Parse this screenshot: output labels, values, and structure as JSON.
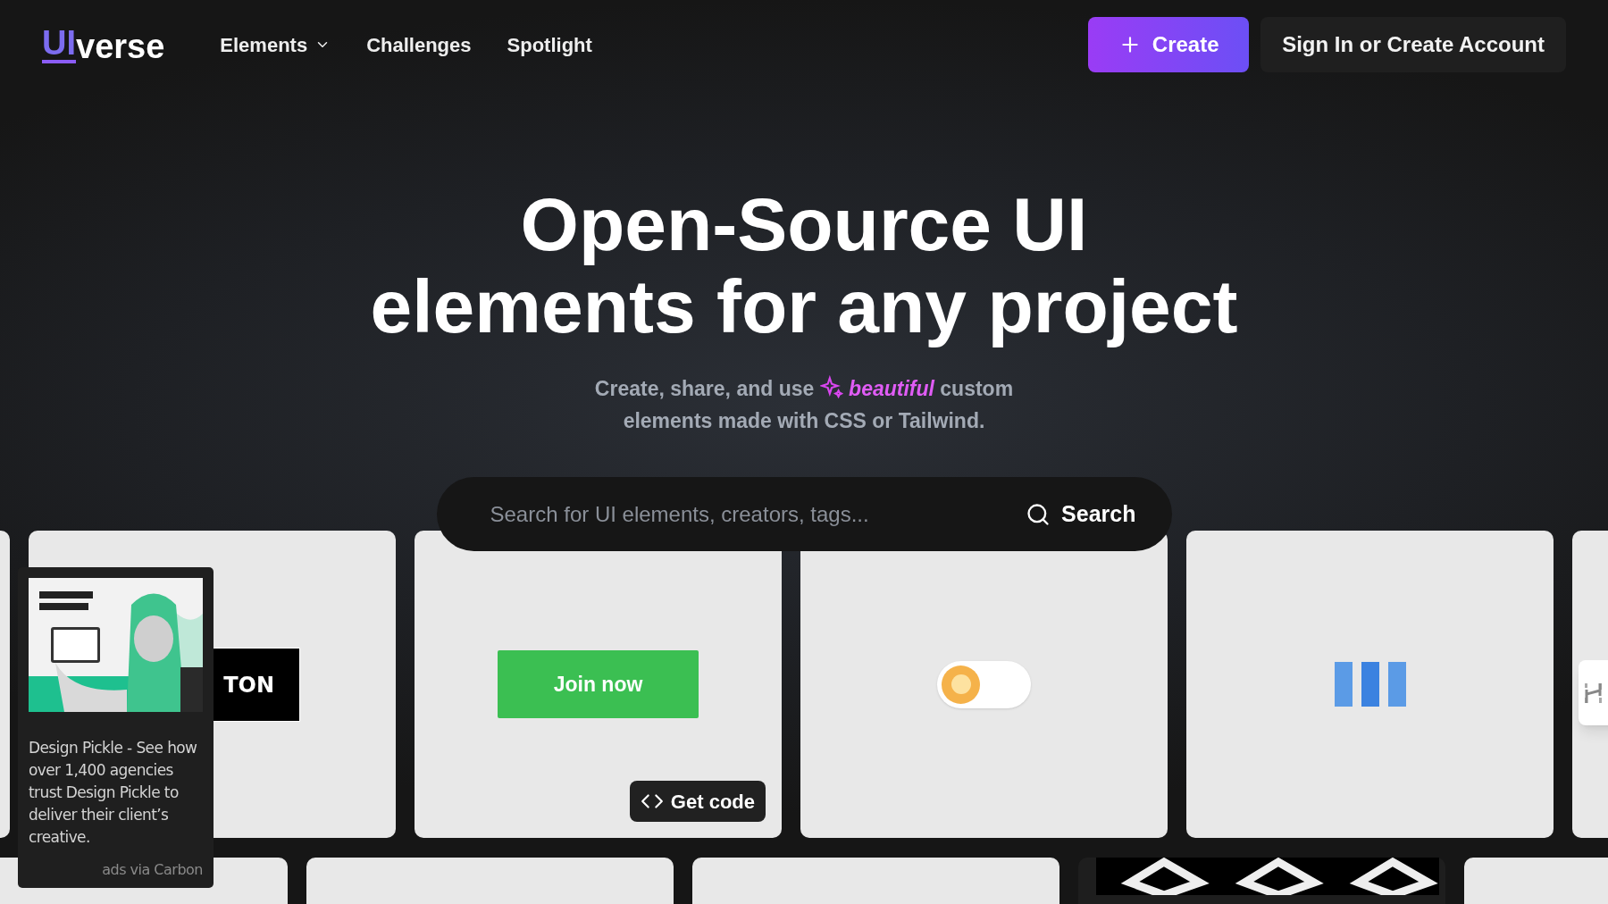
{
  "logo": {
    "prefix": "UI",
    "suffix": "verse"
  },
  "nav": [
    {
      "label": "Elements",
      "dropdown": true
    },
    {
      "label": "Challenges",
      "dropdown": false
    },
    {
      "label": "Spotlight",
      "dropdown": false
    }
  ],
  "actions": {
    "create": "Create",
    "sign_in": "Sign In or Create Account"
  },
  "hero": {
    "title_line_1": "Open-Source UI",
    "title_line_2": "elements for any project",
    "subtitle_start": "Create, share, and use",
    "subtitle_highlight": "beautiful",
    "subtitle_end": "custom",
    "subtitle_line_2": "elements made with CSS or Tailwind."
  },
  "search": {
    "placeholder": "Search for UI elements, creators, tags...",
    "button": "Search"
  },
  "cards": [
    {
      "kind": "blank"
    },
    {
      "kind": "black-button",
      "text": "TON"
    },
    {
      "kind": "green-button",
      "text": "Join now",
      "get_code": "Get code"
    },
    {
      "kind": "toggle",
      "on": false
    },
    {
      "kind": "bars"
    },
    {
      "kind": "edge-icon"
    }
  ],
  "cards_row_2": [
    {
      "kind": "blank"
    },
    {
      "kind": "blank"
    },
    {
      "kind": "blank"
    },
    {
      "kind": "diamonds"
    },
    {
      "kind": "blank"
    }
  ],
  "ad": {
    "kind": "picture",
    "text": "Design Pickle - See how over 1,400 agencies trust Design Pickle to deliver their client’s creative.",
    "via": "ads via Carbon"
  }
}
